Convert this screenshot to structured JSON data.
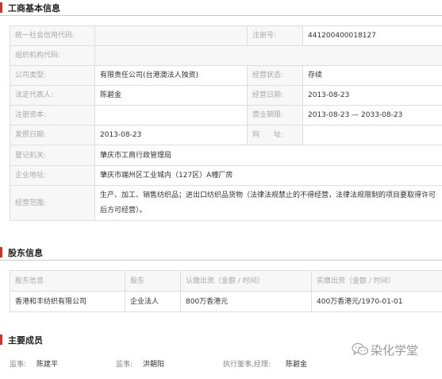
{
  "business_info": {
    "title": "工商基本信息",
    "labels": {
      "credit_code": "统一社会信用代码:",
      "reg_no": "注册号:",
      "org_code": "组织机构代码:",
      "company_type": "公司类型:",
      "status": "经营状态:",
      "legal_rep": "法定代表人:",
      "operate_date": "经营日期:",
      "reg_capital": "注册资本:",
      "term": "营业期限:",
      "issue_date": "发照日期:",
      "website": "网　　址:",
      "authority": "登记机关:",
      "address": "企业地址:",
      "scope": "经营范围:"
    },
    "values": {
      "credit_code": "",
      "reg_no": "441200400018127",
      "org_code": "",
      "company_type": "有限责任公司(台港澳法人独资)",
      "status": "存续",
      "legal_rep": "陈碧金",
      "operate_date": "2013-08-23",
      "reg_capital": "",
      "term": "2013-08-23 — 2033-08-23",
      "issue_date": "2013-08-23",
      "website": "",
      "authority": "肇庆市工商行政管理局",
      "address": "肇庆市端州区工业城内（127区）A幢厂房",
      "scope": "生产、加工、销售纺织品；进出口纺织品货物（法律法规禁止的不得经营，法律法规限制的项目要取得许可后方可经营）。"
    }
  },
  "shareholders": {
    "title": "股东信息",
    "headers": [
      "股东信息",
      "股东",
      "认缴出资（金额 / 时间）",
      "实缴出资（金额 / 时间）"
    ],
    "rows": [
      [
        "香港和丰纺织有限公司",
        "企业法人",
        "800万香港元",
        "400万香港元/1970-01-01"
      ]
    ]
  },
  "members": {
    "title": "主要成员",
    "items": [
      {
        "role": "监事:",
        "name": "陈建平"
      },
      {
        "role": "监事:",
        "name": "洪朝阳"
      },
      {
        "role": "执行董事,经理:",
        "name": "陈碧金"
      }
    ]
  },
  "watermark": {
    "text": "染化学堂",
    "icon": "wechat-icon"
  },
  "colors": {
    "accent": "#c0392b",
    "label_bg": "#f7f7f7",
    "border": "#dedede"
  }
}
